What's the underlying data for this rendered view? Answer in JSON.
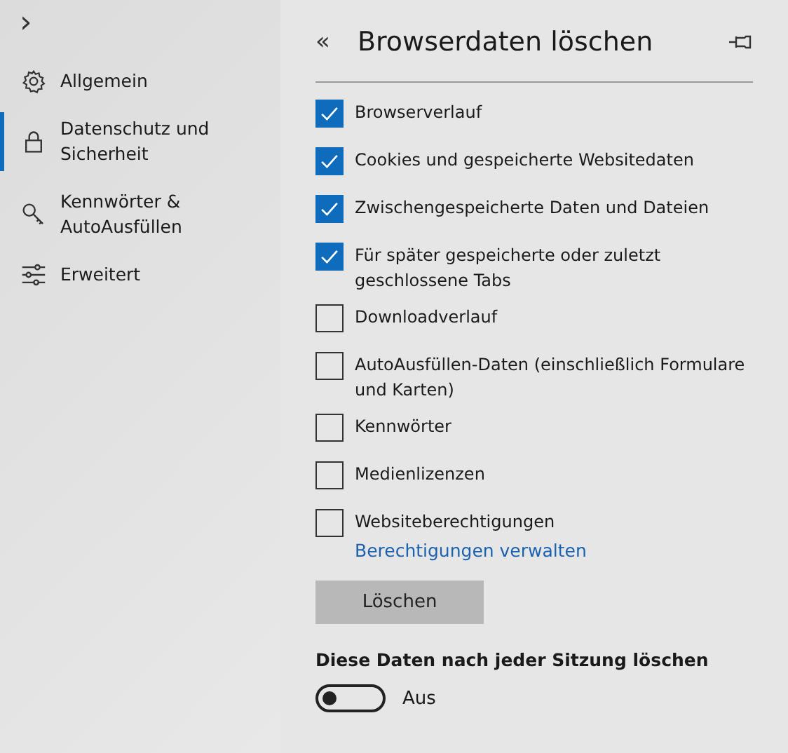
{
  "sidebar": {
    "expand_glyph": "›",
    "items": [
      {
        "label": "Allgemein",
        "selected": false
      },
      {
        "label": "Datenschutz und Sicherheit",
        "selected": true
      },
      {
        "label": "Kennwörter & AutoAusfüllen",
        "selected": false
      },
      {
        "label": "Erweitert",
        "selected": false
      }
    ]
  },
  "panel": {
    "back_glyph": "«",
    "title": "Browserdaten löschen",
    "options": [
      {
        "label": "Browserverlauf",
        "checked": true
      },
      {
        "label": "Cookies und gespeicherte Websitedaten",
        "checked": true
      },
      {
        "label": "Zwischengespeicherte Daten und Dateien",
        "checked": true
      },
      {
        "label": "Für später gespeicherte oder zuletzt geschlossene Tabs",
        "checked": true
      },
      {
        "label": "Downloadverlauf",
        "checked": false
      },
      {
        "label": "AutoAusfüllen-Daten (einschließlich Formulare und Karten)",
        "checked": false
      },
      {
        "label": "Kennwörter",
        "checked": false
      },
      {
        "label": "Medienlizenzen",
        "checked": false
      },
      {
        "label": "Websiteberechtigungen",
        "checked": false
      }
    ],
    "link": "Berechtigungen verwalten",
    "button": "Löschen",
    "session_heading": "Diese Daten nach jeder Sitzung löschen",
    "toggle": {
      "on": false,
      "label": "Aus"
    }
  }
}
